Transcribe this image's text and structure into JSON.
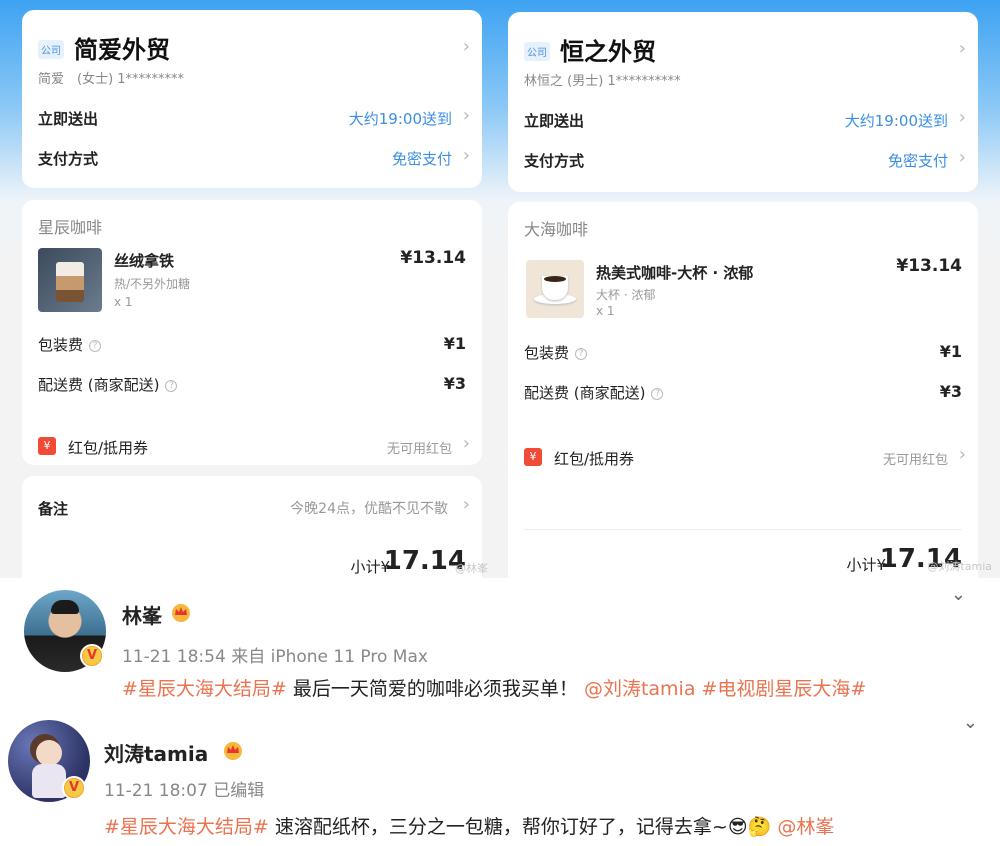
{
  "left": {
    "company_tag": "公司",
    "shop_name": "简爱外贸",
    "contact": "简爱　(女士)  1*********",
    "send_label": "立即送出",
    "send_value": "大约19:00送到",
    "pay_label": "支付方式",
    "pay_value": "免密支付",
    "store": "星辰咖啡",
    "item_name": "丝绒拿铁",
    "item_spec": "热/不另外加糖",
    "item_qty": "x 1",
    "item_price": "¥13.14",
    "pack_label": "包装费",
    "pack_value": "¥1",
    "delivery_label": "配送费 (商家配送)",
    "delivery_value": "¥3",
    "redpack_icon": "¥",
    "redpack_label": "红包/抵用券",
    "redpack_value": "无可用红包",
    "note_label": "备注",
    "note_value": "今晚24点，优酷不见不散",
    "subtotal_label": "小计¥",
    "subtotal_value": "17.14",
    "watermark": "@林峯"
  },
  "right": {
    "company_tag": "公司",
    "shop_name": "恒之外贸",
    "contact": "林恒之 (男士)  1**********",
    "send_label": "立即送出",
    "send_value": "大约19:00送到",
    "pay_label": "支付方式",
    "pay_value": "免密支付",
    "store": "大海咖啡",
    "item_name": "热美式咖啡-大杯 · 浓郁",
    "item_spec": "大杯 · 浓郁",
    "item_qty": "x 1",
    "item_price": "¥13.14",
    "pack_label": "包装费",
    "pack_value": "¥1",
    "delivery_label": "配送费 (商家配送)",
    "delivery_value": "¥3",
    "redpack_icon": "¥",
    "redpack_label": "红包/抵用券",
    "redpack_value": "无可用红包",
    "subtotal_label": "小计¥",
    "subtotal_value": "17.14",
    "watermark": "@刘涛tamia"
  },
  "post1": {
    "username": "林峯",
    "meta": "11-21 18:54  来自 iPhone 11 Pro Max",
    "hashtag1": "#星辰大海大结局#",
    "text": " 最后一天简爱的咖啡必须我买单！ ",
    "mention": "@刘涛tamia",
    "hashtag2": " #电视剧星辰大海#"
  },
  "post2": {
    "username": "刘涛tamia",
    "meta": "11-21 18:07  已编辑",
    "hashtag1": "#星辰大海大结局#",
    "text": " 速溶配纸杯，三分之一包糖，帮你订好了，记得去拿~",
    "emoji": "😎🤔",
    "mention": " @林峯"
  },
  "icons": {
    "chevron": "chevron-right-icon",
    "collapse": "chevron-down-icon",
    "help": "question-circle-icon",
    "verified": "verified-v-icon",
    "crown": "crown-icon"
  },
  "colors": {
    "accent_blue": "#3a8ee6",
    "hashtag": "#eb7350",
    "redpack": "#ef4b36"
  }
}
